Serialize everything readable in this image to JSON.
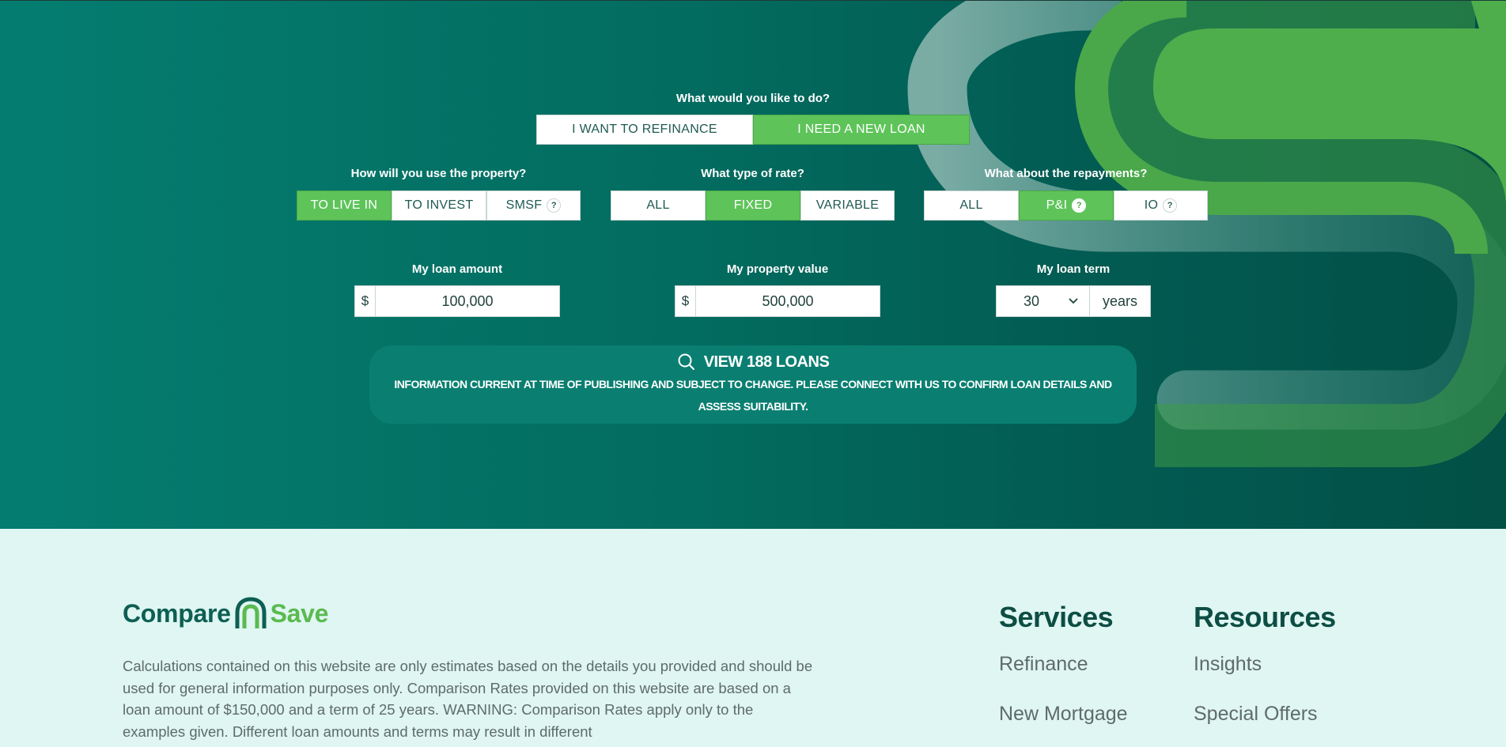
{
  "hero": {
    "goal": {
      "label": "What would you like to do?",
      "options": [
        {
          "label": "I WANT TO REFINANCE",
          "active": false
        },
        {
          "label": "I NEED A NEW LOAN",
          "active": true
        }
      ]
    },
    "property_use": {
      "label": "How will you use the property?",
      "options": [
        {
          "label": "TO LIVE IN",
          "active": true
        },
        {
          "label": "TO INVEST",
          "active": false
        },
        {
          "label": "SMSF",
          "active": false,
          "help": "?"
        }
      ]
    },
    "rate_type": {
      "label": "What type of rate?",
      "options": [
        {
          "label": "ALL",
          "active": false
        },
        {
          "label": "FIXED",
          "active": true
        },
        {
          "label": "VARIABLE",
          "active": false
        }
      ]
    },
    "repayments": {
      "label": "What about the repayments?",
      "options": [
        {
          "label": "ALL",
          "active": false
        },
        {
          "label": "P&I",
          "active": true,
          "help": "?"
        },
        {
          "label": "IO",
          "active": false,
          "help": "?"
        }
      ]
    },
    "loan_amount": {
      "label": "My loan amount",
      "prefix": "$",
      "value": "100,000"
    },
    "property_value": {
      "label": "My property value",
      "prefix": "$",
      "value": "500,000"
    },
    "loan_term": {
      "label": "My loan term",
      "value": "30",
      "suffix": "years"
    },
    "view_button": {
      "title": "VIEW 188 LOANS",
      "note": "INFORMATION CURRENT AT TIME OF PUBLISHING AND SUBJECT TO CHANGE. PLEASE CONNECT WITH US TO CONFIRM LOAN DETAILS AND ASSESS SUITABILITY."
    }
  },
  "footer": {
    "logo": {
      "part1": "Compare",
      "part2": "Save"
    },
    "disclaimer": "Calculations contained on this website are only estimates based on the details you provided and should be used for general information purposes only. Comparison Rates provided on this website are based on a loan amount of $150,000 and a term of 25 years. WARNING: Comparison Rates apply only to the examples given. Different loan amounts and terms may result in different",
    "services": {
      "heading": "Services",
      "links": [
        "Refinance",
        "New Mortgage"
      ]
    },
    "resources": {
      "heading": "Resources",
      "links": [
        "Insights",
        "Special Offers"
      ]
    }
  },
  "colors": {
    "hero_dark": "#025046",
    "hero_light": "#047d70",
    "accent_green": "#5ec45a",
    "footer_bg": "#dff6f2"
  },
  "icons": {
    "search": "search-icon",
    "chevron": "chevron-down-icon",
    "logo": "logo-arch-icon"
  }
}
